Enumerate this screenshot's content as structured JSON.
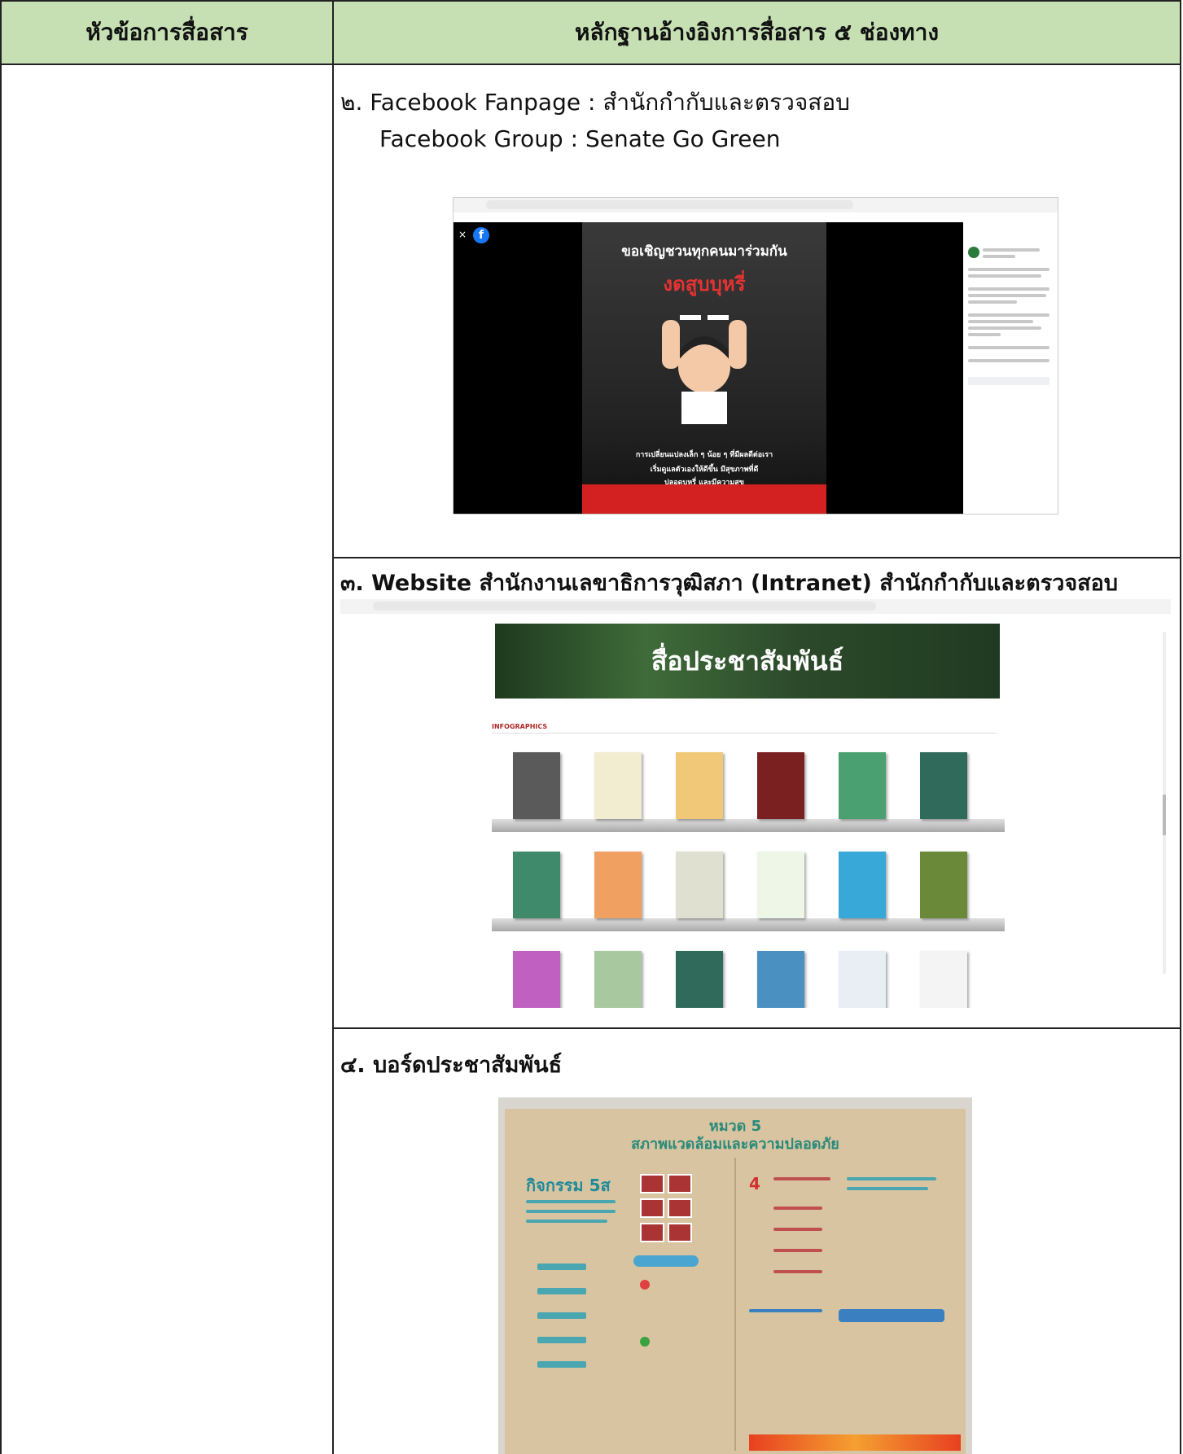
{
  "header": {
    "col1": "หัวข้อการสื่อสาร",
    "col2": "หลักฐานอ้างอิงการสื่อสาร ๕ ช่องทาง"
  },
  "section2": {
    "line1": "๒. Facebook Fanpage : สำนักกำกับและตรวจสอบ",
    "line2": "Facebook Group : Senate Go Green",
    "poster_title": "ขอเชิญชวนทุกคนมาร่วมกัน",
    "poster_red": "งดสูบบุหรี่",
    "poster_line1": "การเปลี่ยนแปลงเล็ก ๆ น้อย ๆ ที่มีผลดีต่อเรา",
    "poster_line2": "เริ่มดูแลตัวเองให้ดีขึ้น มีสุขภาพที่ดี",
    "poster_line3": "ปลอดบุหรี่ และมีความสุข"
  },
  "section3": {
    "title": "๓. Website สำนักงานเลขาธิการวุฒิสภา (Intranet) สำนักกำกับและตรวจสอบ",
    "banner": "สื่อประชาสัมพันธ์",
    "infographics_label": "INFOGRAPHICS"
  },
  "section4": {
    "title": "๔. บอร์ดประชาสัมพันธ์",
    "board_title1": "หมวด 5",
    "board_title2": "สภาพแวดล้อมและความปลอดภัย",
    "board_left": "กิจกรรม 5ส"
  },
  "colors": {
    "header_bg": "#c6e0b4",
    "border": "#222222"
  }
}
